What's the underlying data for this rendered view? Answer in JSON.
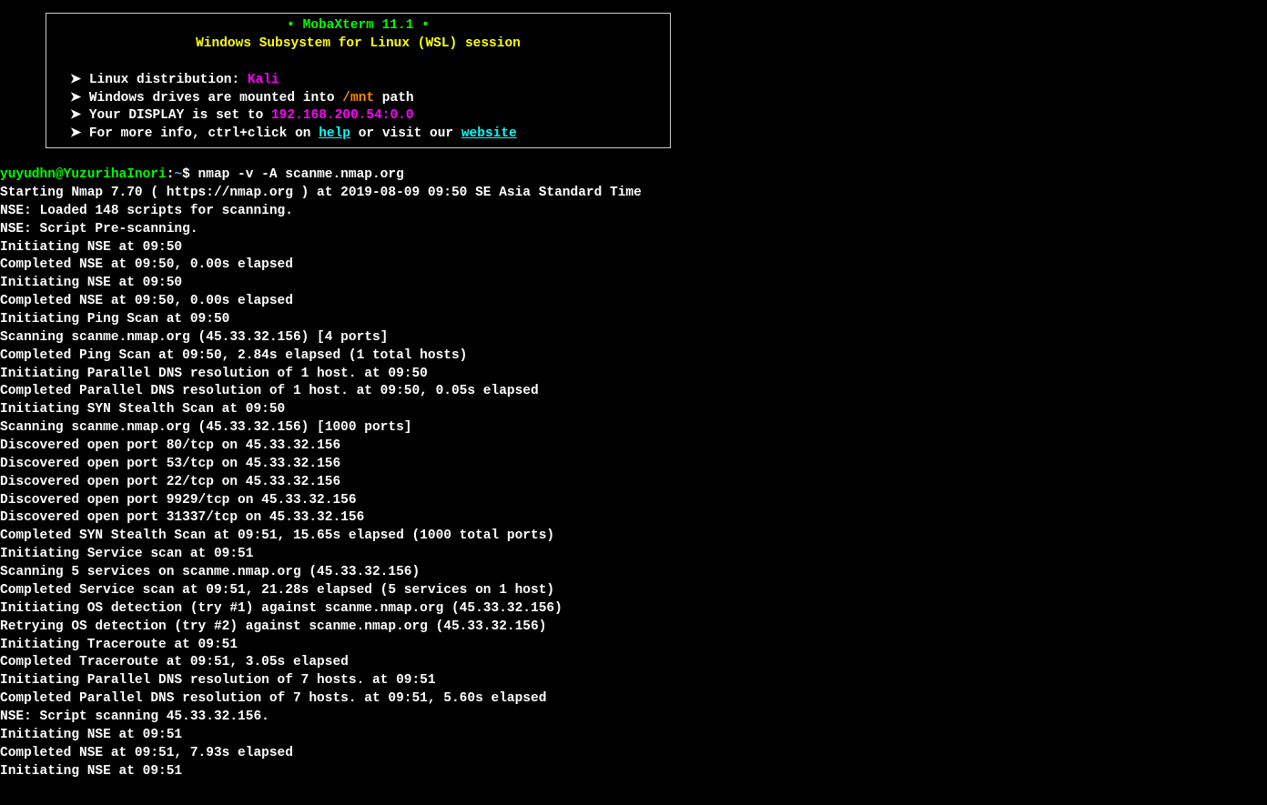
{
  "banner": {
    "title": "• MobaXterm 11.1 •",
    "subtitle": "Windows Subsystem for Linux (WSL) session",
    "items": [
      {
        "prefix": "➤ Linux distribution: ",
        "highlight": "Kali",
        "highlightClass": "magenta",
        "suffix": ""
      },
      {
        "prefix": "➤ Windows drives are mounted into ",
        "highlight": "/mnt",
        "highlightClass": "orange",
        "suffix": " path"
      },
      {
        "prefix": "➤ Your DISPLAY is set to ",
        "highlight": "192.168.200.54:0.0",
        "highlightClass": "magenta",
        "suffix": ""
      },
      {
        "prefix": "➤ For more info, ctrl+click on ",
        "link1": "help",
        "mid": " or visit our ",
        "link2": "website",
        "suffix": ""
      }
    ]
  },
  "prompt": {
    "userhost": "yuyudhn@YuzurihaInori",
    "colon": ":",
    "path": "~",
    "dollar": "$",
    "command": " nmap -v -A scanme.nmap.org"
  },
  "output": [
    "Starting Nmap 7.70 ( https://nmap.org ) at 2019-08-09 09:50 SE Asia Standard Time",
    "NSE: Loaded 148 scripts for scanning.",
    "NSE: Script Pre-scanning.",
    "Initiating NSE at 09:50",
    "Completed NSE at 09:50, 0.00s elapsed",
    "Initiating NSE at 09:50",
    "Completed NSE at 09:50, 0.00s elapsed",
    "Initiating Ping Scan at 09:50",
    "Scanning scanme.nmap.org (45.33.32.156) [4 ports]",
    "Completed Ping Scan at 09:50, 2.84s elapsed (1 total hosts)",
    "Initiating Parallel DNS resolution of 1 host. at 09:50",
    "Completed Parallel DNS resolution of 1 host. at 09:50, 0.05s elapsed",
    "Initiating SYN Stealth Scan at 09:50",
    "Scanning scanme.nmap.org (45.33.32.156) [1000 ports]",
    "Discovered open port 80/tcp on 45.33.32.156",
    "Discovered open port 53/tcp on 45.33.32.156",
    "Discovered open port 22/tcp on 45.33.32.156",
    "Discovered open port 9929/tcp on 45.33.32.156",
    "Discovered open port 31337/tcp on 45.33.32.156",
    "Completed SYN Stealth Scan at 09:51, 15.65s elapsed (1000 total ports)",
    "Initiating Service scan at 09:51",
    "Scanning 5 services on scanme.nmap.org (45.33.32.156)",
    "Completed Service scan at 09:51, 21.28s elapsed (5 services on 1 host)",
    "Initiating OS detection (try #1) against scanme.nmap.org (45.33.32.156)",
    "Retrying OS detection (try #2) against scanme.nmap.org (45.33.32.156)",
    "Initiating Traceroute at 09:51",
    "Completed Traceroute at 09:51, 3.05s elapsed",
    "Initiating Parallel DNS resolution of 7 hosts. at 09:51",
    "Completed Parallel DNS resolution of 7 hosts. at 09:51, 5.60s elapsed",
    "NSE: Script scanning 45.33.32.156.",
    "Initiating NSE at 09:51",
    "Completed NSE at 09:51, 7.93s elapsed",
    "Initiating NSE at 09:51"
  ]
}
